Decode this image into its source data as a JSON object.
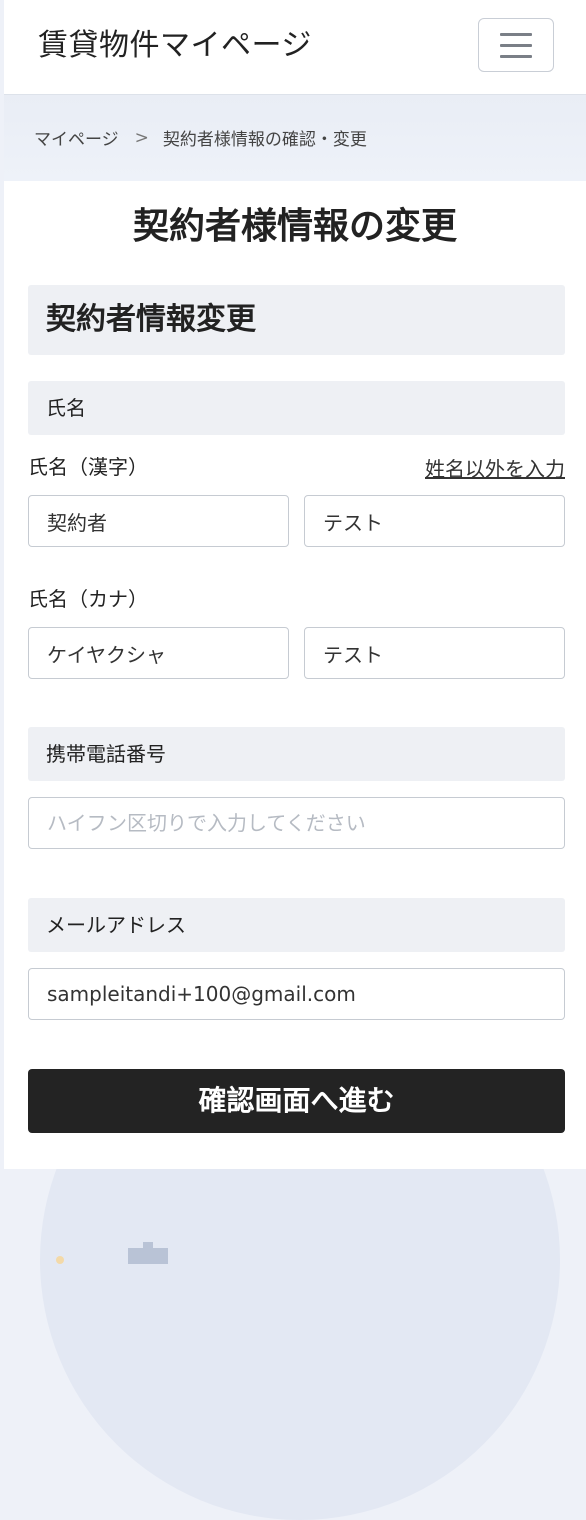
{
  "header": {
    "app_title": "賃貸物件マイページ",
    "menu_icon": "hamburger-menu-icon"
  },
  "breadcrumb": {
    "home_label": "マイページ",
    "separator": ">",
    "current_label": "契約者様情報の確認・変更"
  },
  "main": {
    "page_title": "契約者様情報の変更",
    "section_title": "契約者情報変更",
    "name_group": {
      "heading": "氏名",
      "kanji_label": "氏名（漢字）",
      "other_name_link": "姓名以外を入力",
      "kanji_last_value": "契約者",
      "kanji_first_value": "テスト",
      "kana_label": "氏名（カナ）",
      "kana_last_value": "ケイヤクシャ",
      "kana_first_value": "テスト"
    },
    "phone_group": {
      "heading": "携帯電話番号",
      "placeholder": "ハイフン区切りで入力してください",
      "value": ""
    },
    "email_group": {
      "heading": "メールアドレス",
      "value": "sampleitandi+100@gmail.com"
    },
    "submit_label": "確認画面へ進む"
  },
  "colors": {
    "submit_background": "#232323",
    "section_background": "#eef0f4",
    "page_background": "#eef1f8"
  }
}
